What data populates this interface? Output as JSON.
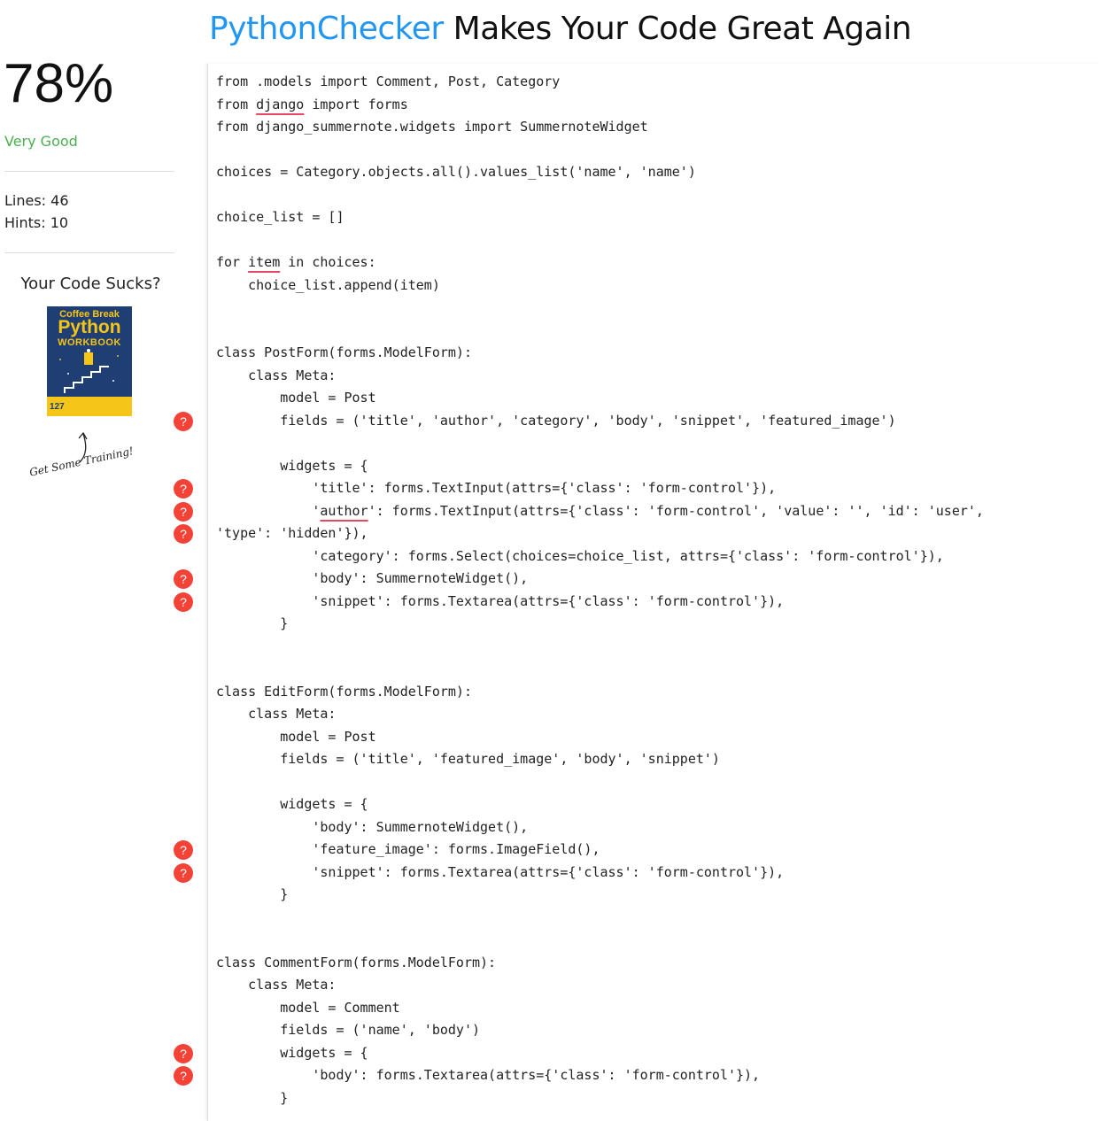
{
  "header": {
    "brand": "PythonChecker",
    "tagline": "Makes Your Code Great Again"
  },
  "sidebar": {
    "score": "78%",
    "rating": "Very Good",
    "lines": "Lines: 46",
    "hints": "Hints: 10",
    "promo_heading": "Your Code Sucks?",
    "book": {
      "line1": "Coffee Break",
      "line2": "Python",
      "line3": "WORKBOOK",
      "number": "127"
    },
    "training": "Get Some Training!",
    "hint_icon": "?"
  },
  "colors": {
    "brand": "#2196f3",
    "rating": "#4caf50",
    "hint": "#f44336",
    "underline": "#e8475f"
  },
  "code": [
    "from .models import Comment, Post, Category",
    "from django import forms",
    "from django_summernote.widgets import SummernoteWidget",
    "",
    "choices = Category.objects.all().values_list('name', 'name')",
    "",
    "choice_list = []",
    "",
    "for item in choices:",
    "    choice_list.append(item)",
    "",
    "",
    "class PostForm(forms.ModelForm):",
    "    class Meta:",
    "        model = Post",
    "        fields = ('title', 'author', 'category', 'body', 'snippet', 'featured_image')",
    "",
    "        widgets = {",
    "            'title': forms.TextInput(attrs={'class': 'form-control'}),",
    "            'author': forms.TextInput(attrs={'class': 'form-control', 'value': '', 'id': 'user',",
    "'type': 'hidden'}),",
    "            'category': forms.Select(choices=choice_list, attrs={'class': 'form-control'}),",
    "            'body': SummernoteWidget(),",
    "            'snippet': forms.Textarea(attrs={'class': 'form-control'}),",
    "        }",
    "",
    "",
    "class EditForm(forms.ModelForm):",
    "    class Meta:",
    "        model = Post",
    "        fields = ('title', 'featured_image', 'body', 'snippet')",
    "",
    "        widgets = {",
    "            'body': SummernoteWidget(),",
    "            'feature_image': forms.ImageField(),",
    "            'snippet': forms.Textarea(attrs={'class': 'form-control'}),",
    "        }",
    "",
    "",
    "class CommentForm(forms.ModelForm):",
    "    class Meta:",
    "        model = Comment",
    "        fields = ('name', 'body')",
    "        widgets = {",
    "            'body': forms.Textarea(attrs={'class': 'form-control'}),",
    "        }"
  ],
  "underlines": [
    {
      "line": 1,
      "text": "django"
    },
    {
      "line": 8,
      "text": "item"
    },
    {
      "line": 19,
      "text": "author"
    }
  ],
  "hint_lines": [
    15,
    18,
    19,
    20,
    22,
    23,
    34,
    35,
    43,
    44
  ]
}
